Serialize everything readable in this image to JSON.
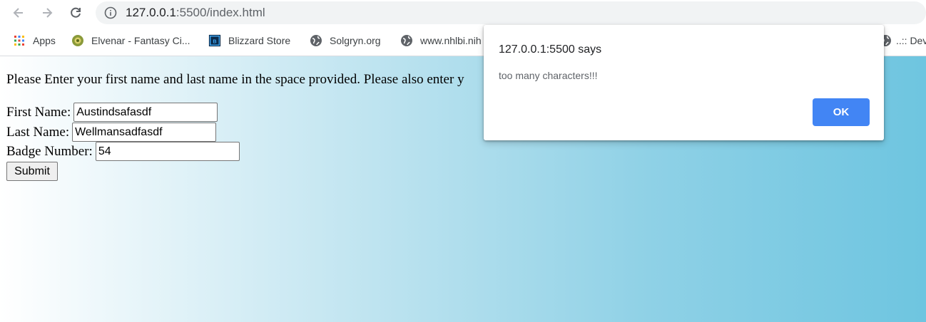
{
  "browser": {
    "url_host": "127.0.0.1",
    "url_path": ":5500/index.html",
    "bookmarks": [
      {
        "label": "Apps",
        "icon": "apps-grid-icon"
      },
      {
        "label": "Elvenar - Fantasy Ci...",
        "icon": "elvenar-icon"
      },
      {
        "label": "Blizzard Store",
        "icon": "blizzard-icon"
      },
      {
        "label": "Solgryn.org",
        "icon": "globe-icon"
      },
      {
        "label": "www.nhlbi.nih",
        "icon": "globe-icon"
      },
      {
        "label": "..:: Dev",
        "icon": "globe-icon"
      }
    ]
  },
  "page": {
    "intro_text": "Please Enter your first name and last name in the space provided. Please also enter y",
    "first_name_label": "First Name:",
    "first_name_value": "Austindsafasdf",
    "last_name_label": "Last Name:",
    "last_name_value": "Wellmansadfasdf",
    "badge_label": "Badge Number:",
    "badge_value": "54",
    "submit_label": "Submit"
  },
  "alert": {
    "title": "127.0.0.1:5500 says",
    "message": "too many characters!!!",
    "ok_label": "OK"
  },
  "colors": {
    "accent": "#4285f4",
    "gradient_end": "#6ec5e0"
  }
}
